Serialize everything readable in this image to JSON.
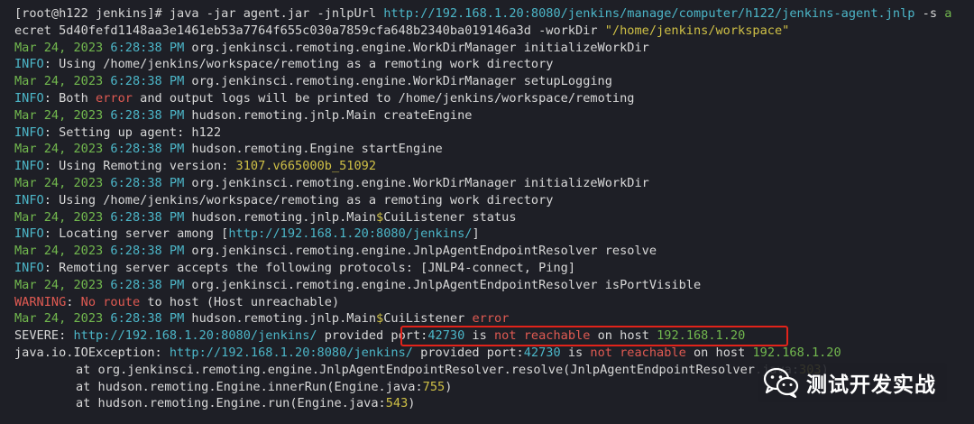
{
  "terminal": {
    "lines": [
      [
        {
          "t": "[root@h122 jenkins]# java -jar agent.jar -jnlpUrl ",
          "c": "text"
        },
        {
          "t": "http://192.168.1.20:8080/jenkins/manage/computer/h122/jenkins-agent.jnlp",
          "c": "cyan"
        },
        {
          "t": " -s ",
          "c": "text"
        },
        {
          "t": "a",
          "c": "green"
        }
      ],
      [
        {
          "t": "ecret 5d40fefd1148aa3e1461eb53a7764f655c030a7859cfa648b2340ba019146a3d -workDir ",
          "c": "text"
        },
        {
          "t": "\"/home/jenkins/workspace\"",
          "c": "yellow"
        }
      ],
      [
        {
          "t": "Mar 24, 2023 ",
          "c": "green"
        },
        {
          "t": "6:28:38 PM",
          "c": "cyan"
        },
        {
          "t": " org.jenkinsci.remoting.engine.WorkDirManager initializeWorkDir",
          "c": "text"
        }
      ],
      [
        {
          "t": "INFO",
          "c": "cyan"
        },
        {
          "t": ": Using /home/jenkins/workspace/remoting as a remoting work directory",
          "c": "text"
        }
      ],
      [
        {
          "t": "Mar 24, 2023 ",
          "c": "green"
        },
        {
          "t": "6:28:38 PM",
          "c": "cyan"
        },
        {
          "t": " org.jenkinsci.remoting.engine.WorkDirManager setupLogging",
          "c": "text"
        }
      ],
      [
        {
          "t": "INFO",
          "c": "cyan"
        },
        {
          "t": ": Both ",
          "c": "text"
        },
        {
          "t": "error",
          "c": "red"
        },
        {
          "t": " and output logs will be printed to /home/jenkins/workspace/remoting",
          "c": "text"
        }
      ],
      [
        {
          "t": "Mar 24, 2023 ",
          "c": "green"
        },
        {
          "t": "6:28:38 PM",
          "c": "cyan"
        },
        {
          "t": " hudson.remoting.jnlp.Main createEngine",
          "c": "text"
        }
      ],
      [
        {
          "t": "INFO",
          "c": "cyan"
        },
        {
          "t": ": Setting up agent: h122",
          "c": "text"
        }
      ],
      [
        {
          "t": "Mar 24, 2023 ",
          "c": "green"
        },
        {
          "t": "6:28:38 PM",
          "c": "cyan"
        },
        {
          "t": " hudson.remoting.Engine startEngine",
          "c": "text"
        }
      ],
      [
        {
          "t": "INFO",
          "c": "cyan"
        },
        {
          "t": ": Using Remoting version: ",
          "c": "text"
        },
        {
          "t": "3107.v665000b_51092",
          "c": "yellow"
        }
      ],
      [
        {
          "t": "Mar 24, 2023 ",
          "c": "green"
        },
        {
          "t": "6:28:38 PM",
          "c": "cyan"
        },
        {
          "t": " org.jenkinsci.remoting.engine.WorkDirManager initializeWorkDir",
          "c": "text"
        }
      ],
      [
        {
          "t": "INFO",
          "c": "cyan"
        },
        {
          "t": ": Using /home/jenkins/workspace/remoting as a remoting work directory",
          "c": "text"
        }
      ],
      [
        {
          "t": "Mar 24, 2023 ",
          "c": "green"
        },
        {
          "t": "6:28:38 PM",
          "c": "cyan"
        },
        {
          "t": " hudson.remoting.jnlp.Main",
          "c": "text"
        },
        {
          "t": "$",
          "c": "yellow"
        },
        {
          "t": "CuiListener status",
          "c": "text"
        }
      ],
      [
        {
          "t": "INFO",
          "c": "cyan"
        },
        {
          "t": ": Locating server among [",
          "c": "text"
        },
        {
          "t": "http://192.168.1.20:8080/jenkins/",
          "c": "cyan"
        },
        {
          "t": "]",
          "c": "text"
        }
      ],
      [
        {
          "t": "Mar 24, 2023 ",
          "c": "green"
        },
        {
          "t": "6:28:38 PM",
          "c": "cyan"
        },
        {
          "t": " org.jenkinsci.remoting.engine.JnlpAgentEndpointResolver resolve",
          "c": "text"
        }
      ],
      [
        {
          "t": "INFO",
          "c": "cyan"
        },
        {
          "t": ": Remoting server accepts the following protocols: [JNLP4-connect, Ping]",
          "c": "text"
        }
      ],
      [
        {
          "t": "Mar 24, 2023 ",
          "c": "green"
        },
        {
          "t": "6:28:38 PM",
          "c": "cyan"
        },
        {
          "t": " org.jenkinsci.remoting.engine.JnlpAgentEndpointResolver isPortVisible",
          "c": "text"
        }
      ],
      [
        {
          "t": "WARNING",
          "c": "red"
        },
        {
          "t": ": ",
          "c": "text"
        },
        {
          "t": "No route",
          "c": "red"
        },
        {
          "t": " to host (Host unreachable)",
          "c": "text"
        }
      ],
      [
        {
          "t": "Mar 24, 2023 ",
          "c": "green"
        },
        {
          "t": "6:28:38 PM",
          "c": "cyan"
        },
        {
          "t": " hudson.remoting.jnlp.Main",
          "c": "text"
        },
        {
          "t": "$",
          "c": "yellow"
        },
        {
          "t": "CuiListener ",
          "c": "text"
        },
        {
          "t": "error",
          "c": "red"
        }
      ],
      [
        {
          "t": "SEVERE",
          "c": "text"
        },
        {
          "t": ": ",
          "c": "text"
        },
        {
          "t": "http://192.168.1.20:8080/jenkins/",
          "c": "cyan"
        },
        {
          "t": " provided ",
          "c": "text"
        },
        {
          "t": "port:",
          "c": "text"
        },
        {
          "t": "42730",
          "c": "cyan"
        },
        {
          "t": " is ",
          "c": "text"
        },
        {
          "t": "not reachable",
          "c": "red"
        },
        {
          "t": " on host ",
          "c": "text"
        },
        {
          "t": "192.168.1.20",
          "c": "green"
        }
      ],
      [
        {
          "t": "java.io.IOException: ",
          "c": "text"
        },
        {
          "t": "http://192.168.1.20:8080/jenkins/",
          "c": "cyan"
        },
        {
          "t": " provided port:",
          "c": "text"
        },
        {
          "t": "42730",
          "c": "cyan"
        },
        {
          "t": " is ",
          "c": "text"
        },
        {
          "t": "not reachable",
          "c": "red"
        },
        {
          "t": " on host ",
          "c": "text"
        },
        {
          "t": "192.168.1.20",
          "c": "green"
        }
      ],
      [
        {
          "t": "at org.jenkinsci.remoting.engine.JnlpAgentEndpointResolver.resolve(JnlpAgentEndpointResolver.java:",
          "c": "text"
        },
        {
          "t": "303",
          "c": "yellow"
        },
        {
          "t": ")",
          "c": "text"
        }
      ],
      [
        {
          "t": "at hudson.remoting.Engine.innerRun(Engine.java:",
          "c": "text"
        },
        {
          "t": "755",
          "c": "yellow"
        },
        {
          "t": ")",
          "c": "text"
        }
      ],
      [
        {
          "t": "at hudson.remoting.Engine.run(Engine.java:",
          "c": "text"
        },
        {
          "t": "543",
          "c": "yellow"
        },
        {
          "t": ")",
          "c": "text"
        }
      ]
    ],
    "indented_lines": [
      21,
      22,
      23
    ],
    "highlighted_text": "port:42730 is not reachable on host 192.168.1.20"
  },
  "watermark": {
    "icon": "wechat-icon",
    "text": "测试开发实战"
  },
  "colors": {
    "background": "#1e1f26",
    "text": "#d8d8d8",
    "green": "#72b84e",
    "cyan": "#4cb6c8",
    "red": "#e05a52",
    "yellow": "#cfc046",
    "highlight_border": "#e2231a"
  }
}
